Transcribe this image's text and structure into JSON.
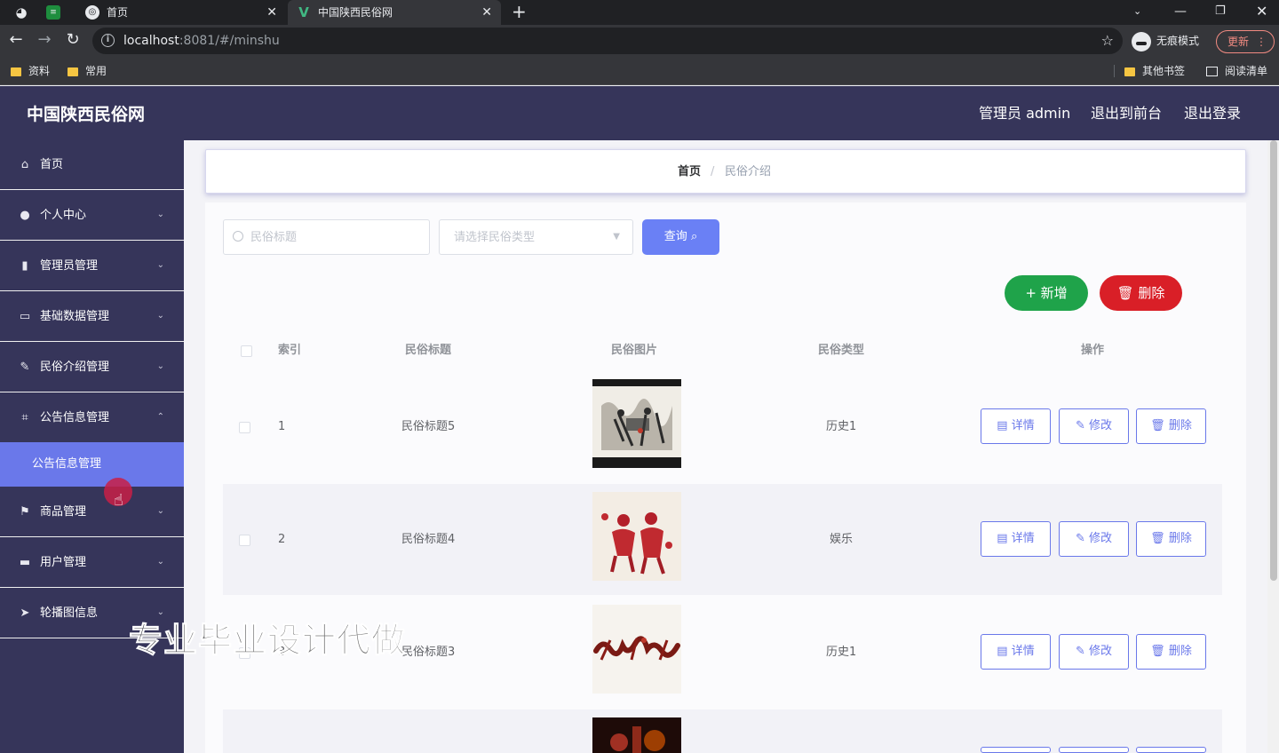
{
  "browser": {
    "tabs": [
      {
        "title": "首页"
      },
      {
        "title": "中国陕西民俗网"
      }
    ],
    "url_host": "localhost",
    "url_rest": ":8081/#/minshu",
    "incognito_label": "无痕模式",
    "update_label": "更新",
    "bookmarks": [
      "资料",
      "常用"
    ],
    "bookmarks_right": [
      "其他书签",
      "阅读清单"
    ]
  },
  "header": {
    "title": "中国陕西民俗网",
    "links": [
      "管理员 admin",
      "退出到前台",
      "退出登录"
    ]
  },
  "sidebar": {
    "items": [
      {
        "label": "首页",
        "icon": "home-icon"
      },
      {
        "label": "个人中心",
        "icon": "user-icon"
      },
      {
        "label": "管理员管理",
        "icon": "bar-chart-icon"
      },
      {
        "label": "基础数据管理",
        "icon": "data-icon"
      },
      {
        "label": "民俗介绍管理",
        "icon": "edit-icon"
      },
      {
        "label": "公告信息管理",
        "icon": "frame-icon"
      },
      {
        "label": "商品管理",
        "icon": "flag-icon"
      },
      {
        "label": "用户管理",
        "icon": "suitcase-icon"
      },
      {
        "label": "轮播图信息",
        "icon": "send-icon"
      }
    ],
    "active_sub": "公告信息管理"
  },
  "breadcrumb": {
    "home": "首页",
    "sep": "/",
    "current": "民俗介绍"
  },
  "search": {
    "title_placeholder": "民俗标题",
    "type_placeholder": "请选择民俗类型",
    "query_label": "查询"
  },
  "actions": {
    "add_label": "新增",
    "delete_label": "删除"
  },
  "table": {
    "headers": [
      "索引",
      "民俗标题",
      "民俗图片",
      "民俗类型",
      "操作"
    ],
    "row_actions": [
      "详情",
      "修改",
      "删除"
    ],
    "rows": [
      {
        "index": "1",
        "title": "民俗标题5",
        "type": "历史1"
      },
      {
        "index": "2",
        "title": "民俗标题4",
        "type": "娱乐"
      },
      {
        "index": "3",
        "title": "民俗标题3",
        "type": "历史1"
      }
    ]
  },
  "watermark": "专业毕业设计代做",
  "colors": {
    "header_bg": "#36355a",
    "accent": "#6a78ea",
    "add": "#1fa34a",
    "delete": "#d91f27"
  }
}
